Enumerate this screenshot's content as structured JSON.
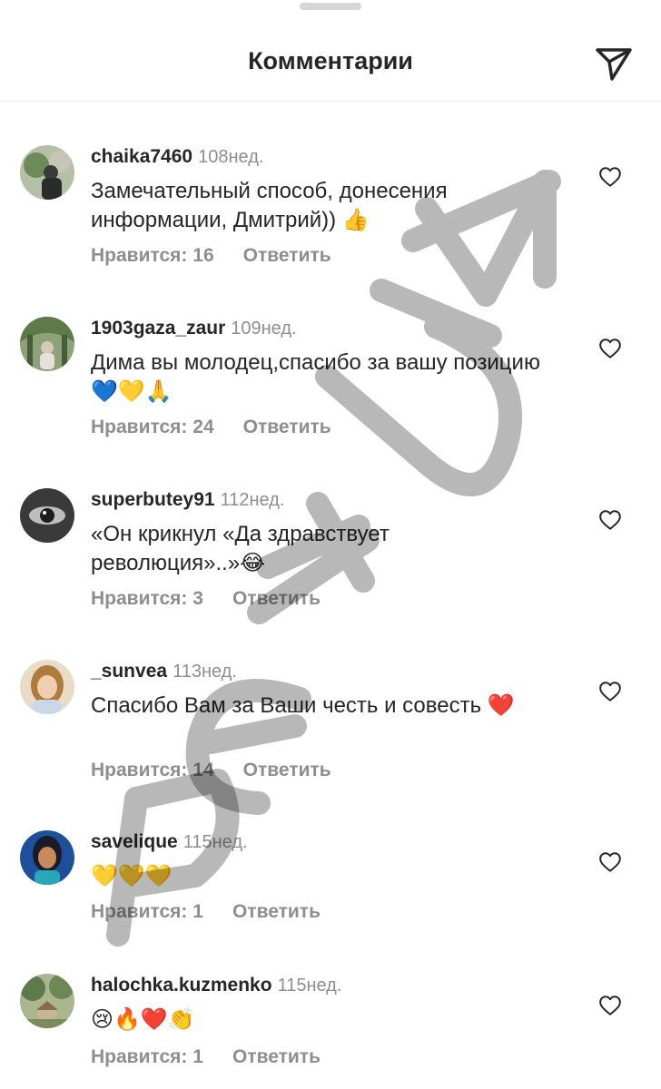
{
  "header": {
    "title": "Комментарии"
  },
  "comments": [
    {
      "username": "chaika7460",
      "time": "108нед.",
      "text": "Замечательный способ, донесения информации, Дмитрий)) 👍",
      "likes": "Нравится: 16",
      "reply": "Ответить"
    },
    {
      "username": "1903gaza_zaur",
      "time": "109нед.",
      "text": "Дима вы молодец,спасибо за вашу позицию 💙💛🙏",
      "likes": "Нравится: 24",
      "reply": "Ответить"
    },
    {
      "username": "superbutey91",
      "time": "112нед.",
      "text": "«Он крикнул «Да здравствует революция»..»😂",
      "likes": "Нравится: 3",
      "reply": "Ответить"
    },
    {
      "username": "_sunvea",
      "time": "113нед.",
      "text": "Спасибо Вам за Ваши честь и совесть ❤️",
      "likes": "Нравится: 14",
      "reply": "Ответить"
    },
    {
      "username": "savelique",
      "time": "115нед.",
      "text": "💛💛💛",
      "likes": "Нравится: 1",
      "reply": "Ответить"
    },
    {
      "username": "halochka.kuzmenko",
      "time": "115нед.",
      "text": "😢🔥❤️👏",
      "likes": "Нравится: 1",
      "reply": "Ответить"
    }
  ],
  "icons": {
    "send": "send-icon",
    "like": "heart-outline-icon"
  },
  "colors": {
    "text": "#262626",
    "secondary": "#8e8e8e",
    "divider": "#e6e6e6"
  }
}
